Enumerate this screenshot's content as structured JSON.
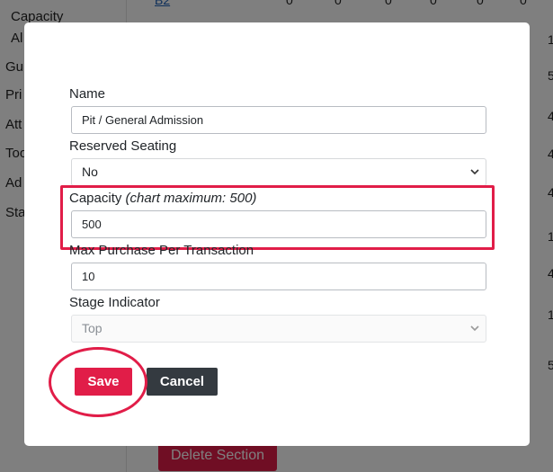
{
  "background": {
    "nav": {
      "capacity": "Capacity",
      "al": "Al",
      "gu": "Gu",
      "pri": "Pri",
      "att": "Att",
      "too": "Too",
      "ad": "Ad",
      "sta": "Sta"
    },
    "row_link": "B2",
    "zeros": [
      "0",
      "0",
      "0",
      "0",
      "0",
      "0"
    ],
    "right_numbers": [
      "1",
      "5",
      "4",
      "4",
      "4",
      "1",
      "4",
      "1",
      "5"
    ],
    "delete_button": "Delete Section"
  },
  "modal": {
    "name": {
      "label": "Name",
      "value": "Pit / General Admission"
    },
    "reserved_seating": {
      "label": "Reserved Seating",
      "value": "No"
    },
    "capacity": {
      "label": "Capacity",
      "hint": "(chart maximum: 500)",
      "value": "500"
    },
    "max_purchase": {
      "label": "Max Purchase Per Transaction",
      "value": "10"
    },
    "stage_indicator": {
      "label": "Stage Indicator",
      "value": "Top"
    },
    "buttons": {
      "save": "Save",
      "cancel": "Cancel"
    }
  },
  "colors": {
    "accent": "#e11d48",
    "cancel": "#343a40",
    "overlay": "rgba(0,0,0,0.5)"
  },
  "icons": {
    "select_chevron": "chevron-down-icon"
  }
}
